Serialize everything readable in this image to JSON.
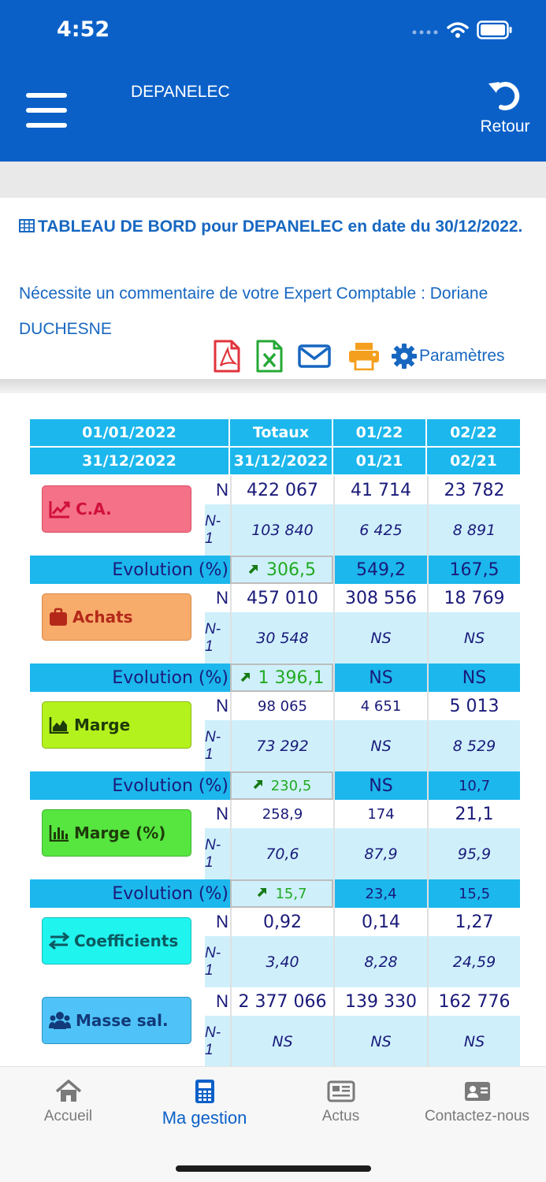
{
  "status": {
    "time": "4:52"
  },
  "header": {
    "title": "DEPANELEC",
    "back_label": "Retour"
  },
  "info": {
    "title": "TABLEAU DE BORD pour DEPANELEC en date du 30/12/2022.",
    "subtitle": "Nécessite un commentaire de votre Expert Comptable : Doriane DUCHESNE",
    "settings_label": "Paramètres"
  },
  "table": {
    "header_row1": [
      "01/01/2022",
      "Totaux",
      "01/22",
      "02/22"
    ],
    "header_row2": [
      "31/12/2022",
      "31/12/2022",
      "01/21",
      "02/21"
    ],
    "n_label": "N",
    "n1_label": "N-1",
    "evo_label": "Evolution (%)",
    "blocks": [
      {
        "label": "C.A.",
        "icon": "chart-line-icon",
        "color": "#f47187",
        "text_color": "#d0103a",
        "n": [
          "422 067",
          "41 714",
          "23 782"
        ],
        "n1": [
          "103 840",
          "6 425",
          "8 891"
        ],
        "evo": [
          "306,5",
          "549,2",
          "167,5"
        ]
      },
      {
        "label": "Achats",
        "icon": "briefcase-icon",
        "color": "#f7ac6b",
        "text_color": "#b4281a",
        "n": [
          "457 010",
          "308 556",
          "18 769"
        ],
        "n1": [
          "30 548",
          "NS",
          "NS"
        ],
        "evo": [
          "1 396,1",
          "NS",
          "NS"
        ]
      },
      {
        "label": "Marge",
        "icon": "area-chart-icon",
        "color": "#b4f21d",
        "text_color": "#1e3b0a",
        "n": [
          "98 065",
          "4 651",
          "5 013"
        ],
        "n1": [
          "73 292",
          "NS",
          "8 529"
        ],
        "evo": [
          "230,5",
          "NS",
          "10,7"
        ]
      },
      {
        "label": "Marge (%)",
        "icon": "bar-chart-icon",
        "color": "#56e63f",
        "text_color": "#1e3b0a",
        "n": [
          "258,9",
          "174",
          "21,1"
        ],
        "n1": [
          "70,6",
          "87,9",
          "95,9"
        ],
        "evo": [
          "15,7",
          "23,4",
          "15,5"
        ]
      },
      {
        "label": "Coefficients",
        "icon": "exchange-icon",
        "color": "#20f4ef",
        "text_color": "#0d5a61",
        "n": [
          "0,92",
          "0,14",
          "1,27"
        ],
        "n1": [
          "3,40",
          "8,28",
          "24,59"
        ]
      },
      {
        "label": "Masse sal.",
        "icon": "users-icon",
        "color": "#4fc3f7",
        "text_color": "#123a7a",
        "n": [
          "2 377 066",
          "139 330",
          "162 776"
        ],
        "n1": [
          "NS",
          "NS",
          "NS"
        ]
      }
    ]
  },
  "tabs": [
    {
      "label": "Accueil",
      "icon": "home-icon"
    },
    {
      "label": "Ma gestion",
      "icon": "calculator-icon"
    },
    {
      "label": "Actus",
      "icon": "newspaper-icon"
    },
    {
      "label": "Contactez-nous",
      "icon": "contact-card-icon"
    }
  ],
  "colors": {
    "primary": "#0b60c8",
    "header_cyan": "#1cb7ec",
    "light_cyan": "#cff0fb",
    "evo_green": "#22aa22"
  }
}
